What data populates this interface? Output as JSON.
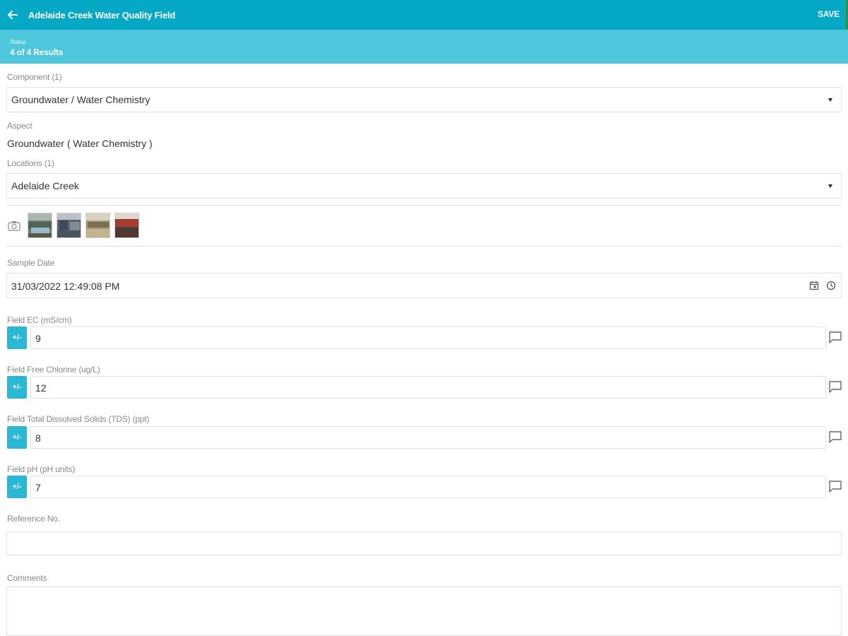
{
  "appbar": {
    "title": "Adelaide Creek Water Quality Field",
    "save_label": "SAVE",
    "back_icon": "arrow-left-icon"
  },
  "status": {
    "label": "Status",
    "value": "4 of 4 Results"
  },
  "component": {
    "label": "Component (1)",
    "value": "Groundwater / Water Chemistry"
  },
  "aspect": {
    "label": "Aspect",
    "value": "Groundwater ( Water Chemistry )"
  },
  "locations": {
    "label": "Locations (1)",
    "value": "Adelaide Creek"
  },
  "photos": {
    "camera_icon": "camera-icon",
    "count": 4
  },
  "sample_date": {
    "label": "Sample Date",
    "value": "31/03/2022 12:49:08 PM",
    "calendar_icon": "calendar-icon",
    "clock_icon": "clock-icon"
  },
  "fields": [
    {
      "label": "Field EC (mS/cm)",
      "value": "9",
      "toggle_label": "+/-"
    },
    {
      "label": "Field Free Chlorine (ug/L)",
      "value": "12",
      "toggle_label": "+/-"
    },
    {
      "label": "Field Total Dissolved Solids (TDS) (ppt)",
      "value": "8",
      "toggle_label": "+/-"
    },
    {
      "label": "Field pH (pH units)",
      "value": "7",
      "toggle_label": "+/-"
    }
  ],
  "reference": {
    "label": "Reference No.",
    "value": ""
  },
  "comments": {
    "label": "Comments",
    "value": ""
  },
  "colors": {
    "appbar": "#05a8c5",
    "statusbar": "#4ec7dc",
    "accent_button": "#29b9d6"
  }
}
